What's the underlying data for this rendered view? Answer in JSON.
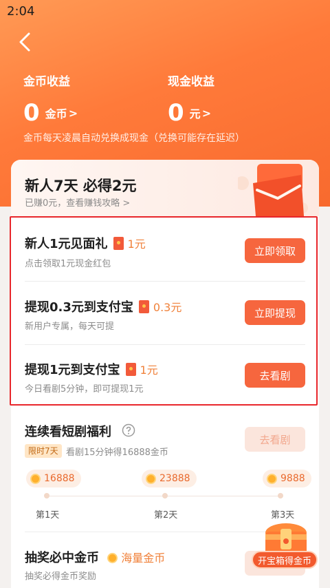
{
  "status": {
    "time": "2:04"
  },
  "earnings": {
    "coins": {
      "title": "金币收益",
      "value": "0",
      "unit": "金币",
      "arrow": ">"
    },
    "cash": {
      "title": "现金收益",
      "value": "0",
      "unit": "元",
      "arrow": ">"
    },
    "note": "金币每天凌晨自动兑换成现金（兑换可能存在延迟）"
  },
  "promo": {
    "title": "新人7天 必得2元",
    "subtitle": "已赚0元，查看赚钱攻略 >"
  },
  "tasks": [
    {
      "title": "新人1元见面礼",
      "amount": "1元",
      "desc": "点击领取1元现金红包",
      "button": "立即领取"
    },
    {
      "title": "提现0.3元到支付宝",
      "amount": "0.3元",
      "desc": "新用户专属，每天可提",
      "button": "立即提现"
    },
    {
      "title": "提现1元到支付宝",
      "amount": "1元",
      "desc": "今日看剧5分钟，即可提现1元",
      "button": "去看剧"
    }
  ],
  "streak": {
    "title": "连续看短剧福利",
    "button": "去看剧",
    "badge": "限时7天",
    "desc": "看剧15分钟得16888金币",
    "rewards": [
      {
        "coins": "16888",
        "day": "第1天"
      },
      {
        "coins": "23888",
        "day": "第2天"
      },
      {
        "coins": "9888",
        "day": "第3天"
      }
    ]
  },
  "lottery": {
    "title": "抽奖必中金币",
    "highlight": "海量金币",
    "desc": "抽奖必得金币奖励"
  },
  "chest": {
    "label": "开宝箱得金币"
  },
  "colors": {
    "accent": "#f6663e",
    "header": "#ff7a3a",
    "highlight_border": "#e8252a"
  }
}
